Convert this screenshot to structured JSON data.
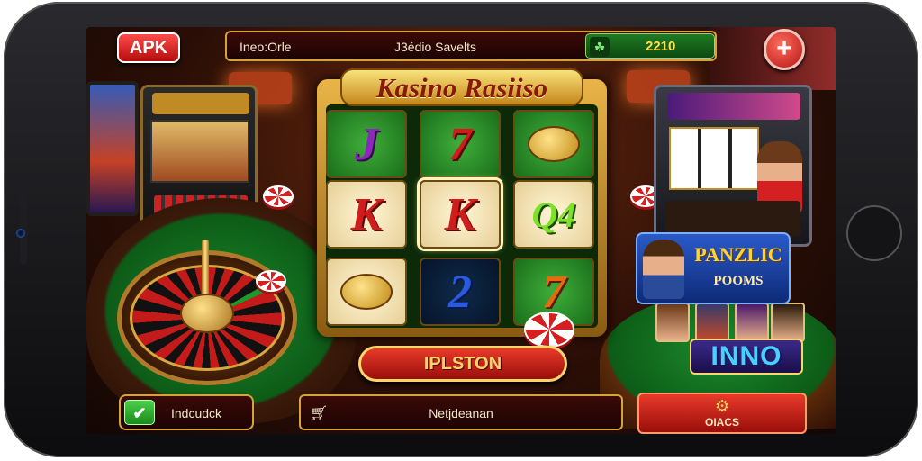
{
  "header": {
    "apk_label": "APK",
    "left_text": "Ineo:Orle",
    "center_text": "J3édio Savelts",
    "coin_icon": "leaf-icon",
    "coin_balance": "2210",
    "close_icon": "plus-icon"
  },
  "game": {
    "title": "Kasino Rasiiso",
    "reels": [
      [
        {
          "symbol": "J",
          "style": "purple",
          "bg": "green"
        },
        {
          "symbol": "K",
          "style": "red",
          "bg": "cream"
        },
        {
          "symbol": "",
          "style": "gold",
          "bg": "cream"
        }
      ],
      [
        {
          "symbol": "7",
          "style": "red",
          "bg": "green"
        },
        {
          "symbol": "K",
          "style": "red",
          "bg": "cream"
        },
        {
          "symbol": "2",
          "style": "blue",
          "bg": "dark"
        }
      ],
      [
        {
          "symbol": "",
          "style": "gold",
          "bg": "green"
        },
        {
          "symbol": "Q4",
          "style": "lime",
          "bg": "cream"
        },
        {
          "symbol": "7",
          "style": "orange",
          "bg": "green"
        }
      ]
    ],
    "spin_label": "IPLSTON"
  },
  "promo": {
    "title": "PANZLIC",
    "subtitle": "POOMS",
    "badge": "INNO"
  },
  "footer": {
    "left_icon": "check-icon",
    "left_label": "Indcudck",
    "mid_icon": "cart-icon",
    "mid_label": "Netjdeanan",
    "right_icon": "gear-icon",
    "right_label": "OIACS"
  },
  "colors": {
    "accent_gold": "#d8a23a",
    "accent_red": "#c31a1a",
    "felt_green": "#1c8b2d",
    "coin_yellow": "#ffe14a"
  }
}
